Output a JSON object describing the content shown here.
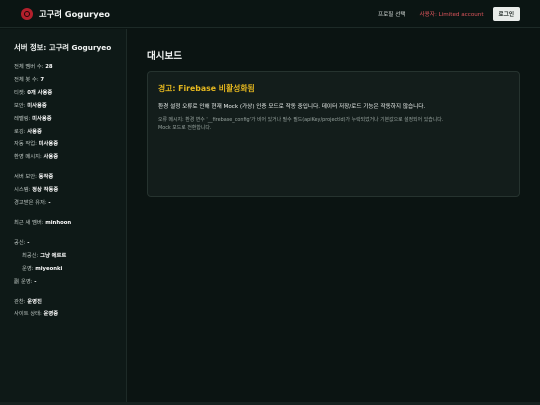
{
  "header": {
    "brand": "고구려 Goguryeo",
    "profile_link": "프로필 선택",
    "user_label": "사용자: Limited account",
    "logout_label": "로그인"
  },
  "sidebar": {
    "title": "서버 정보: 고구려 Goguryeo",
    "rows": [
      {
        "label": "전체 멤버 수:",
        "value": "28"
      },
      {
        "label": "전체 봇 수:",
        "value": "7"
      },
      {
        "label": "티켓:",
        "value": "0개 사용중"
      },
      {
        "label": "보안:",
        "value": "미사용중"
      },
      {
        "label": "레벨링:",
        "value": "미사용중"
      },
      {
        "label": "로깅:",
        "value": "사용중"
      },
      {
        "label": "자동 작업:",
        "value": "미사용중"
      },
      {
        "label": "환영 메시지:",
        "value": "사용중"
      }
    ],
    "rows2": [
      {
        "label": "서버 보안:",
        "value": "동작중"
      },
      {
        "label": "시스템:",
        "value": "정상 작동중"
      },
      {
        "label": "경고받은 유저:",
        "value": "-"
      }
    ],
    "newest_member": {
      "label": "최근 새 멤버:",
      "value": "minhoon"
    },
    "owner": {
      "label": "공신:",
      "value": "-"
    },
    "sub_owner": {
      "label": "최공신:",
      "value": "그냥 에르르"
    },
    "manager": {
      "label": "운영:",
      "value": "miyeonki"
    },
    "sub_manager": {
      "label": "副 운영:",
      "value": "-"
    },
    "admin": {
      "label": "관찬:",
      "value": "운영진"
    },
    "site_status": {
      "label": "사이트 상태:",
      "value": "운영중"
    }
  },
  "main": {
    "title": "대시보드",
    "alert": {
      "title": "경고: Firebase 비활성화됨",
      "message": "환경 설정 오류로 인해 현재 Mock (가상) 인증 모드로 작동 중입니다. 데이터 저장/로드 기능은 작동하지 않습니다.",
      "detail_line1": "오류 메시지: 환경 변수 '__firebase_config'가 비어 있거나 필수 필드(apiKey/projectId)가 누락되었거나 기본값으로 설정되어 있습니다.",
      "detail_line2": "Mock 모드로 전환합니다."
    }
  },
  "colors": {
    "background": "#0b1412",
    "logo": "#b3202c",
    "alert_title": "#e6b81f",
    "user_label": "#e0565d"
  }
}
